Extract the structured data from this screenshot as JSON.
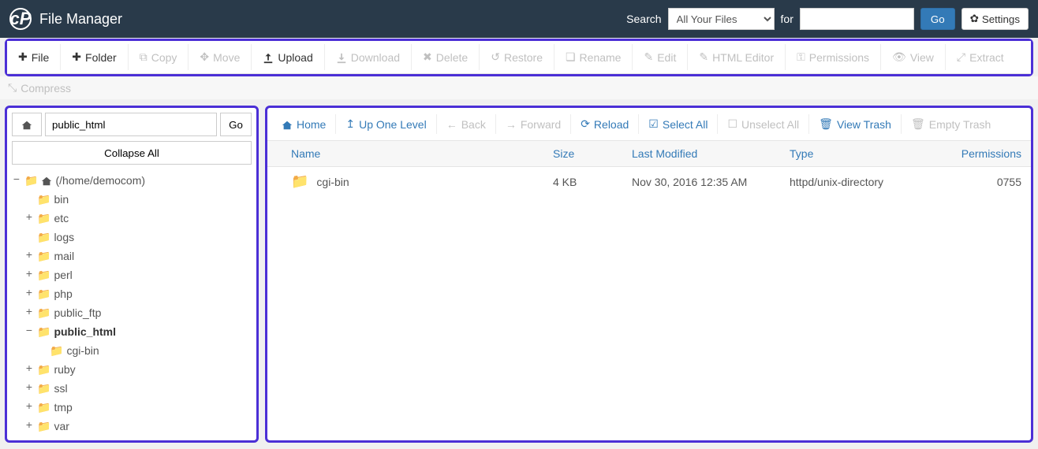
{
  "header": {
    "title": "File Manager",
    "search_label": "Search",
    "search_scope": "All Your Files",
    "for_label": "for",
    "search_value": "",
    "go_label": "Go",
    "settings_label": "Settings"
  },
  "toolbar": {
    "file": "File",
    "folder": "Folder",
    "copy": "Copy",
    "move": "Move",
    "upload": "Upload",
    "download": "Download",
    "delete": "Delete",
    "restore": "Restore",
    "rename": "Rename",
    "edit": "Edit",
    "html_editor": "HTML Editor",
    "permissions": "Permissions",
    "view": "View",
    "extract": "Extract",
    "compress": "Compress"
  },
  "sidebar": {
    "path_value": "public_html",
    "go_label": "Go",
    "collapse_label": "Collapse All",
    "root": {
      "label": "(/home/democom)"
    },
    "items": [
      {
        "label": "bin",
        "toggle": ""
      },
      {
        "label": "etc",
        "toggle": "+"
      },
      {
        "label": "logs",
        "toggle": ""
      },
      {
        "label": "mail",
        "toggle": "+"
      },
      {
        "label": "perl",
        "toggle": "+"
      },
      {
        "label": "php",
        "toggle": "+"
      },
      {
        "label": "public_ftp",
        "toggle": "+"
      },
      {
        "label": "public_html",
        "toggle": "−",
        "bold": true
      },
      {
        "label": "ruby",
        "toggle": "+"
      },
      {
        "label": "ssl",
        "toggle": "+"
      },
      {
        "label": "tmp",
        "toggle": "+"
      },
      {
        "label": "var",
        "toggle": "+"
      }
    ],
    "child": {
      "label": "cgi-bin"
    }
  },
  "nav": {
    "home": "Home",
    "up": "Up One Level",
    "back": "Back",
    "forward": "Forward",
    "reload": "Reload",
    "select_all": "Select All",
    "unselect_all": "Unselect All",
    "view_trash": "View Trash",
    "empty_trash": "Empty Trash"
  },
  "columns": {
    "name": "Name",
    "size": "Size",
    "last_modified": "Last Modified",
    "type": "Type",
    "permissions": "Permissions"
  },
  "rows": [
    {
      "name": "cgi-bin",
      "size": "4 KB",
      "last_modified": "Nov 30, 2016 12:35 AM",
      "type": "httpd/unix-directory",
      "permissions": "0755"
    }
  ]
}
